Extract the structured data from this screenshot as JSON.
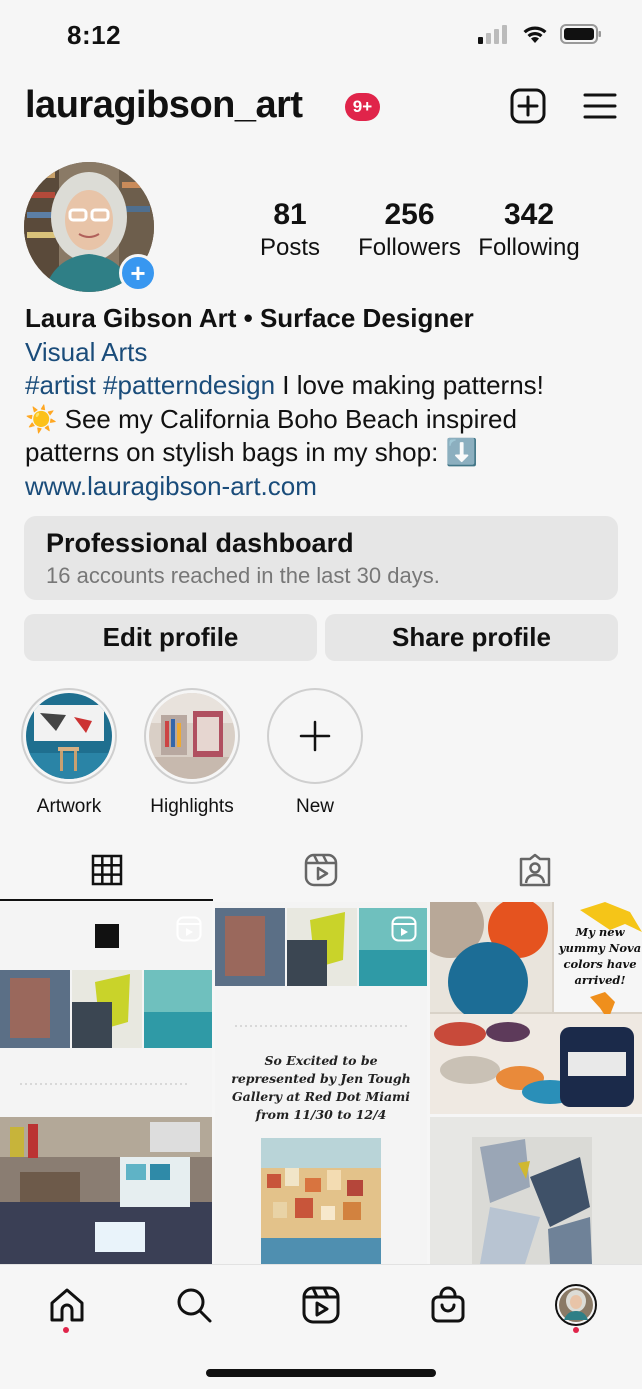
{
  "status": {
    "time": "8:12"
  },
  "header": {
    "username": "lauragibson_art",
    "notification_badge": "9+"
  },
  "stats": {
    "posts": {
      "value": "81",
      "label": "Posts"
    },
    "followers": {
      "value": "256",
      "label": "Followers"
    },
    "following": {
      "value": "342",
      "label": "Following"
    }
  },
  "bio": {
    "name": "Laura Gibson Art • Surface Designer",
    "category": "Visual Arts",
    "tag1": "#artist",
    "tag2": "#patterndesign",
    "line1_rest": " I love making patterns!",
    "line2": "☀️ See my California Boho Beach inspired",
    "line3": "patterns on stylish bags in my shop: ⬇️",
    "link": "www.lauragibson-art.com"
  },
  "dashboard": {
    "title": "Professional dashboard",
    "subtitle": "16 accounts reached in the last 30 days."
  },
  "buttons": {
    "edit": "Edit profile",
    "share": "Share profile"
  },
  "highlights": [
    {
      "label": "Artwork"
    },
    {
      "label": "Highlights"
    },
    {
      "label": "New"
    }
  ],
  "posts": {
    "post2_caption": "So Excited to be represented by Jen Tough Gallery at Red Dot Miami from 11/30 to 12/4",
    "post3_caption": "My new yummy Nova colors have arrived!"
  },
  "colors": {
    "link": "#1a4c7a",
    "badge": "#e0244a",
    "accent_blue": "#3897f0"
  }
}
